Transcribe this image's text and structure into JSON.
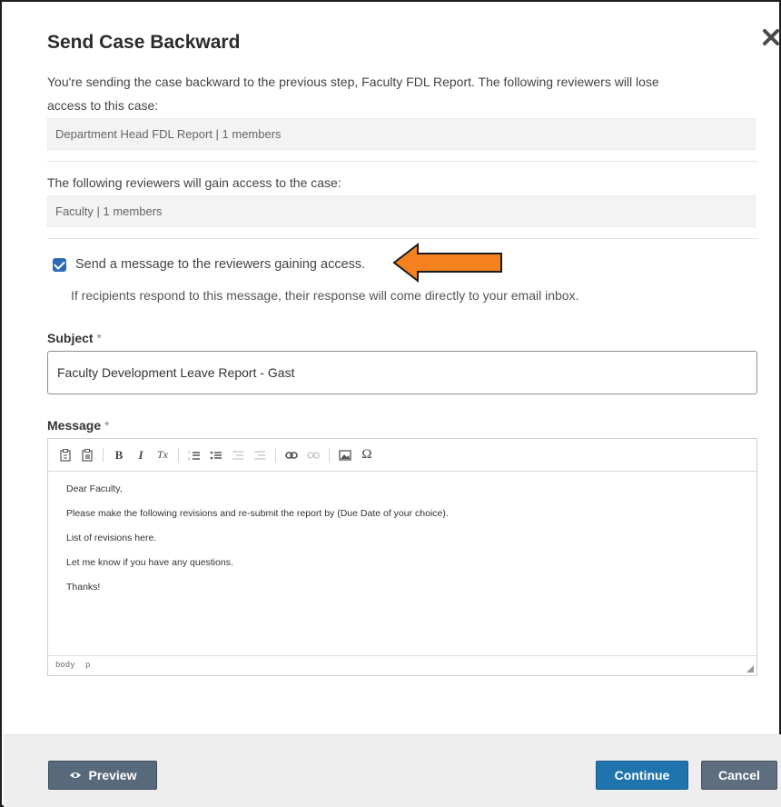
{
  "modal": {
    "title": "Send Case Backward",
    "description_line1": "You're sending the case backward to the previous step, Faculty FDL Report. The following reviewers will lose",
    "description_line2": "access to this case:",
    "losing_reviewers": "Department Head FDL Report | 1 members",
    "gain_label": "The following reviewers will gain access to the case:",
    "gaining_reviewers": "Faculty | 1 members",
    "send_message_label": "Send a message to the reviewers gaining access.",
    "send_message_checked": true,
    "response_hint": "If recipients respond to this message, their response will come directly to your email inbox."
  },
  "form": {
    "subject_label": "Subject",
    "subject_required": "*",
    "subject_value": "Faculty Development Leave Report - Gast",
    "message_label": "Message",
    "message_required": "*"
  },
  "editor": {
    "toolbar_icons": [
      "paste-icon",
      "paste-text-icon",
      "bold-icon",
      "italic-icon",
      "remove-format-icon",
      "numbered-list-icon",
      "bulleted-list-icon",
      "outdent-icon",
      "indent-icon",
      "link-icon",
      "unlink-icon",
      "image-icon",
      "special-char-icon"
    ],
    "bold_glyph": "B",
    "italic_glyph": "I",
    "clear_glyph": "Tx",
    "omega_glyph": "Ω",
    "lines": [
      "Dear Faculty,",
      "Please make the following revisions and re-submit the report by (Due Date of your choice).",
      "List of revisions here.",
      "Let me know if you have any questions.",
      "Thanks!"
    ],
    "path_body": "body",
    "path_p": "p"
  },
  "footer": {
    "preview_label": "Preview",
    "continue_label": "Continue",
    "cancel_label": "Cancel"
  },
  "colors": {
    "accent": "#2074ad",
    "arrow": "#f5821f",
    "checkbox": "#2b6bb3"
  }
}
